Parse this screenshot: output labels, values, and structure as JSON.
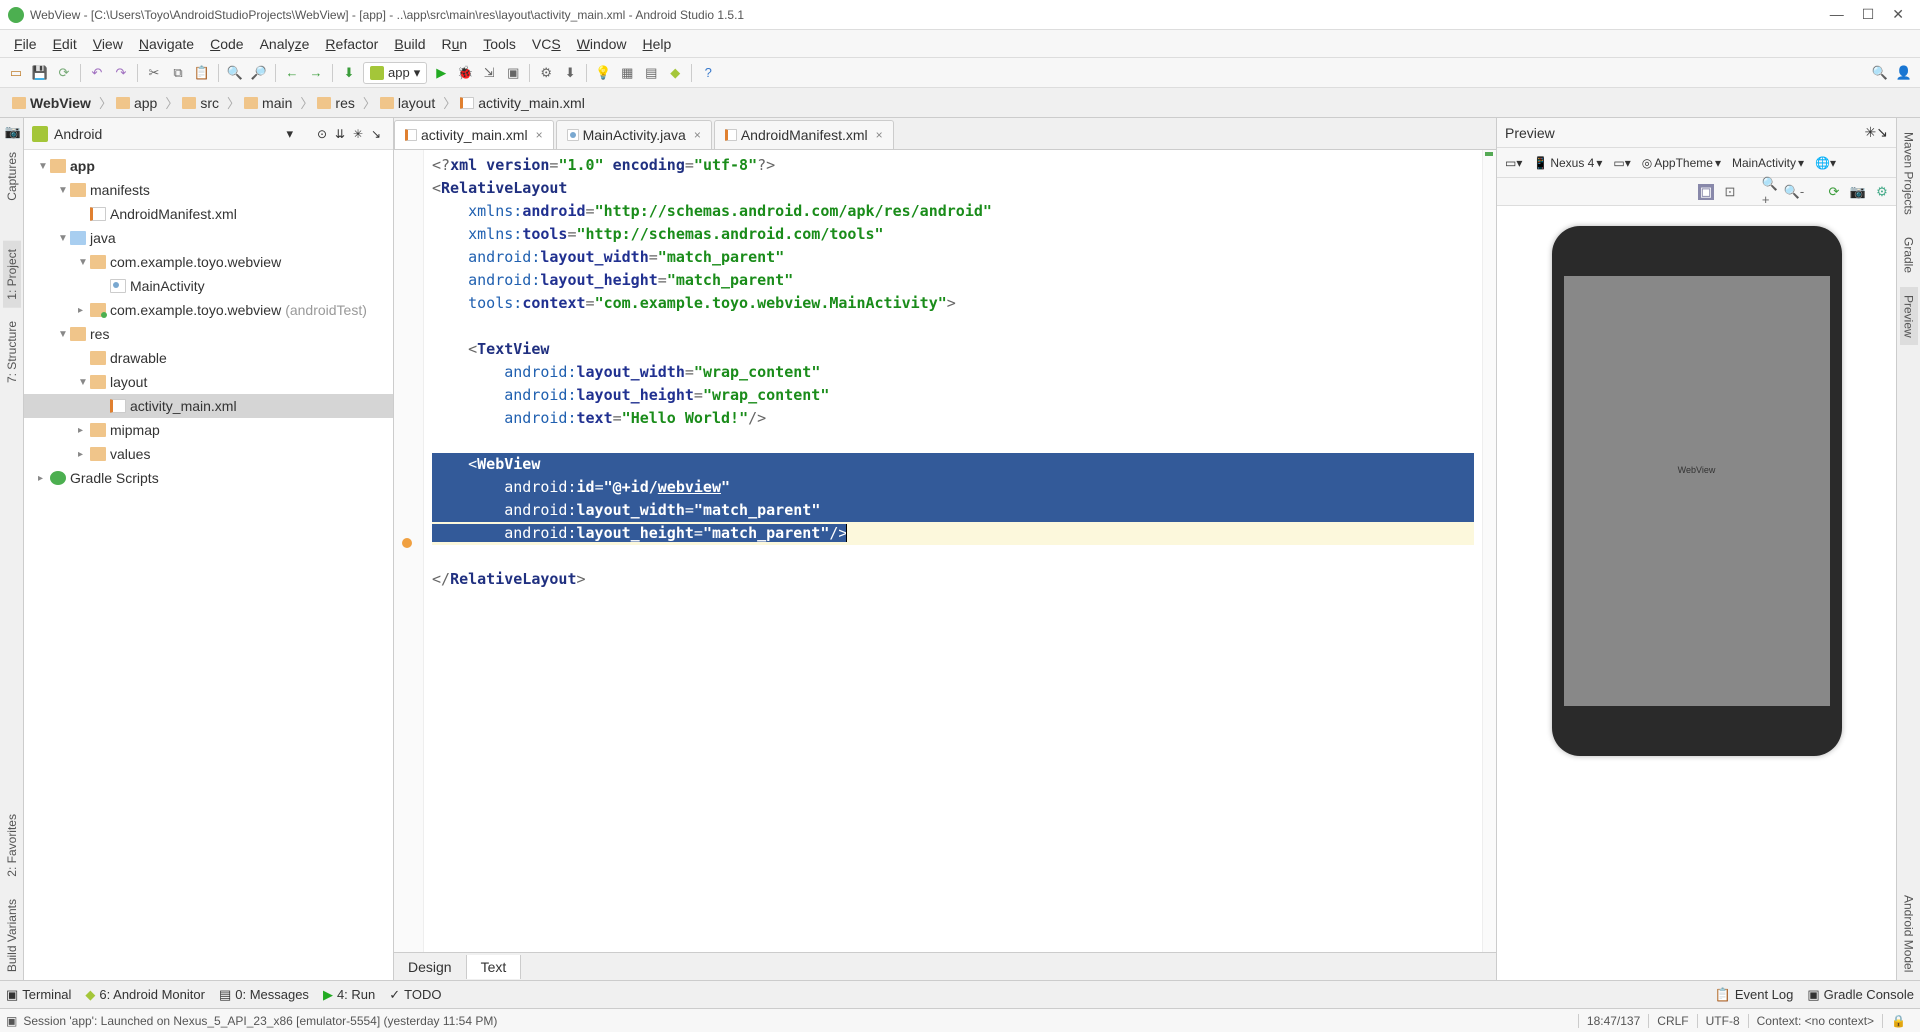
{
  "window_title": "WebView - [C:\\Users\\Toyo\\AndroidStudioProjects\\WebView] - [app] - ..\\app\\src\\main\\res\\layout\\activity_main.xml - Android Studio 1.5.1",
  "menu": [
    "File",
    "Edit",
    "View",
    "Navigate",
    "Code",
    "Analyze",
    "Refactor",
    "Build",
    "Run",
    "Tools",
    "VCS",
    "Window",
    "Help"
  ],
  "module_selector": "app",
  "breadcrumb": [
    "WebView",
    "app",
    "src",
    "main",
    "res",
    "layout",
    "activity_main.xml"
  ],
  "project_panel": {
    "mode": "Android",
    "tree": {
      "app": "app",
      "manifests": "manifests",
      "manifest_file": "AndroidManifest.xml",
      "java": "java",
      "pkg_main": "com.example.toyo.webview",
      "main_activity": "MainActivity",
      "pkg_test": "com.example.toyo.webview",
      "pkg_test_suffix": "(androidTest)",
      "res": "res",
      "drawable": "drawable",
      "layout": "layout",
      "activity_main": "activity_main.xml",
      "mipmap": "mipmap",
      "values": "values",
      "gradle": "Gradle Scripts"
    }
  },
  "tabs": [
    {
      "name": "activity_main.xml",
      "active": true
    },
    {
      "name": "MainActivity.java",
      "active": false
    },
    {
      "name": "AndroidManifest.xml",
      "active": false
    }
  ],
  "code": {
    "xml_version": "1.0",
    "xml_encoding": "utf-8",
    "root_tag": "RelativeLayout",
    "ns_android": "http://schemas.android.com/apk/res/android",
    "ns_tools": "http://schemas.android.com/tools",
    "layout_width": "match_parent",
    "layout_height": "match_parent",
    "tools_context": "com.example.toyo.webview.MainActivity",
    "tv_tag": "TextView",
    "tv_width": "wrap_content",
    "tv_height": "wrap_content",
    "tv_text": "Hello World!",
    "wv_tag": "WebView",
    "wv_id": "@+id/webview",
    "wv_id_display": "webview",
    "wv_width": "match_parent",
    "wv_height": "match_parent",
    "close_root": "RelativeLayout"
  },
  "design_tabs": [
    "Design",
    "Text"
  ],
  "design_tab_active": "Text",
  "preview": {
    "title": "Preview",
    "device": "Nexus 4",
    "theme": "AppTheme",
    "activity": "MainActivity",
    "center_label": "WebView"
  },
  "left_gutter": [
    "Captures",
    "1: Project",
    "7: Structure",
    "2: Favorites",
    "Build Variants"
  ],
  "right_gutter": [
    "Maven Projects",
    "Gradle",
    "Preview",
    "Android Model"
  ],
  "bottom_tabs": [
    "Terminal",
    "6: Android Monitor",
    "0: Messages",
    "4: Run",
    "TODO"
  ],
  "bottom_right": [
    "Event Log",
    "Gradle Console"
  ],
  "status": {
    "msg": "Session 'app': Launched on Nexus_5_API_23_x86 [emulator-5554] (yesterday 11:54 PM)",
    "pos": "18:47/137",
    "line_sep": "CRLF",
    "encoding": "UTF-8",
    "context": "Context: <no context>"
  }
}
